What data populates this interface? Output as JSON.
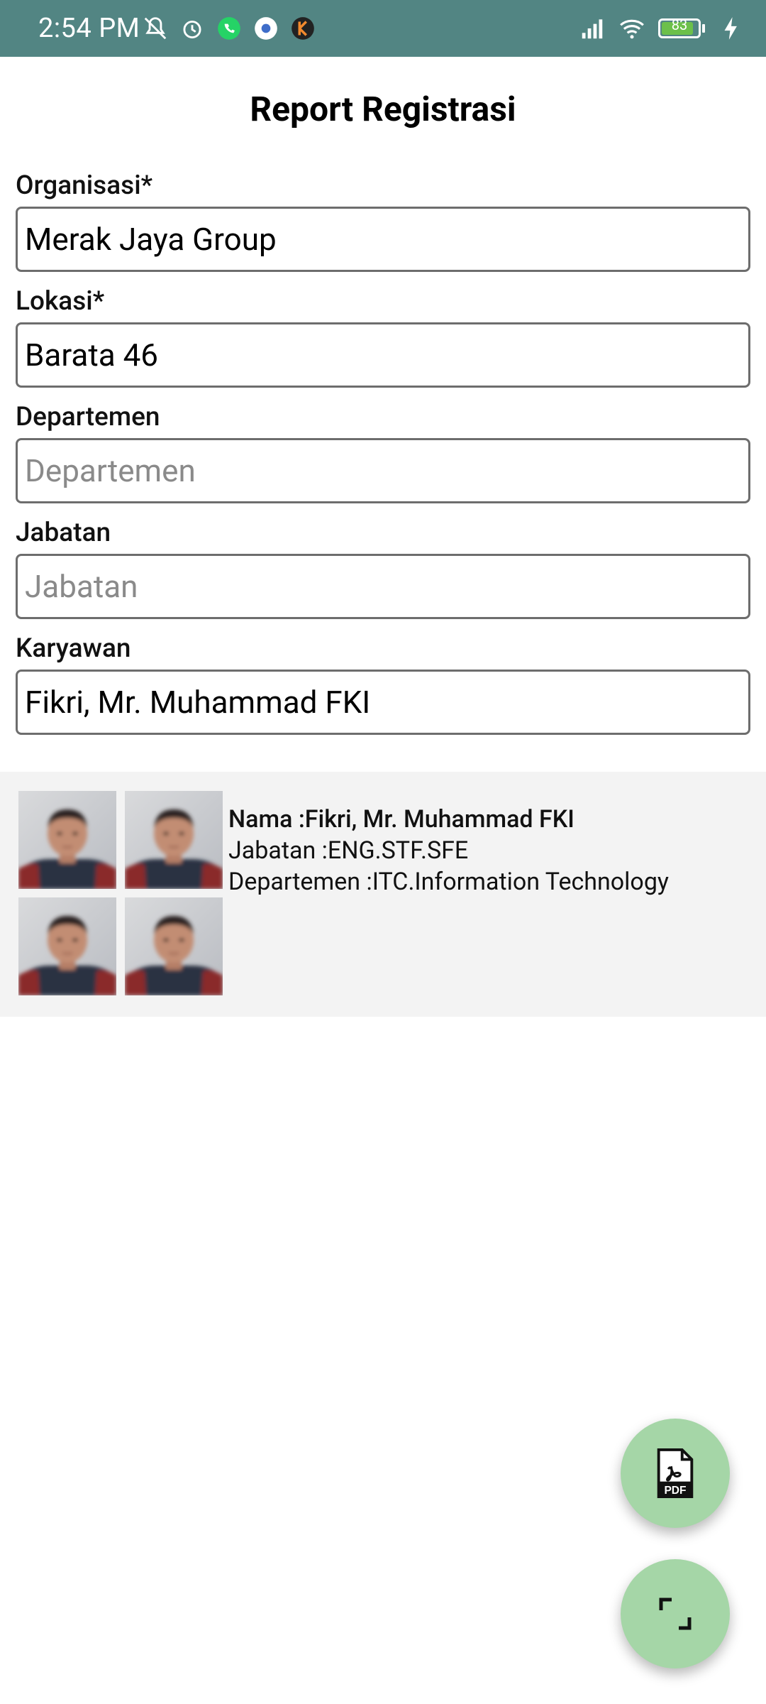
{
  "status_bar": {
    "time": "2:54 PM",
    "battery": "83",
    "icons_left": [
      "muted-bell-icon",
      "alarm-icon",
      "whatsapp-icon",
      "settings-app-icon",
      "k-app-icon"
    ],
    "icons_right": [
      "signal-icon",
      "wifi-icon",
      "battery-icon",
      "charging-icon"
    ]
  },
  "page": {
    "title": "Report Registrasi"
  },
  "form": {
    "organisasi": {
      "label": "Organisasi*",
      "value": "Merak Jaya Group"
    },
    "lokasi": {
      "label": "Lokasi*",
      "value": "Barata 46"
    },
    "departemen": {
      "label": "Departemen",
      "placeholder": "Departemen"
    },
    "jabatan": {
      "label": "Jabatan",
      "placeholder": "Jabatan"
    },
    "karyawan": {
      "label": "Karyawan",
      "value": "Fikri, Mr. Muhammad FKI"
    }
  },
  "result": {
    "nama": "Nama :Fikri, Mr. Muhammad FKI",
    "jabatan": "Jabatan :ENG.STF.SFE",
    "departemen": "Departemen :ITC.Information Technology",
    "photo_count": 4
  },
  "fab": {
    "pdf_icon": "pdf-icon",
    "scan_icon": "scan-corners-icon"
  },
  "colors": {
    "status_bar": "#528583",
    "fab": "#a5d6a7",
    "result_bg": "#f3f3f3"
  }
}
